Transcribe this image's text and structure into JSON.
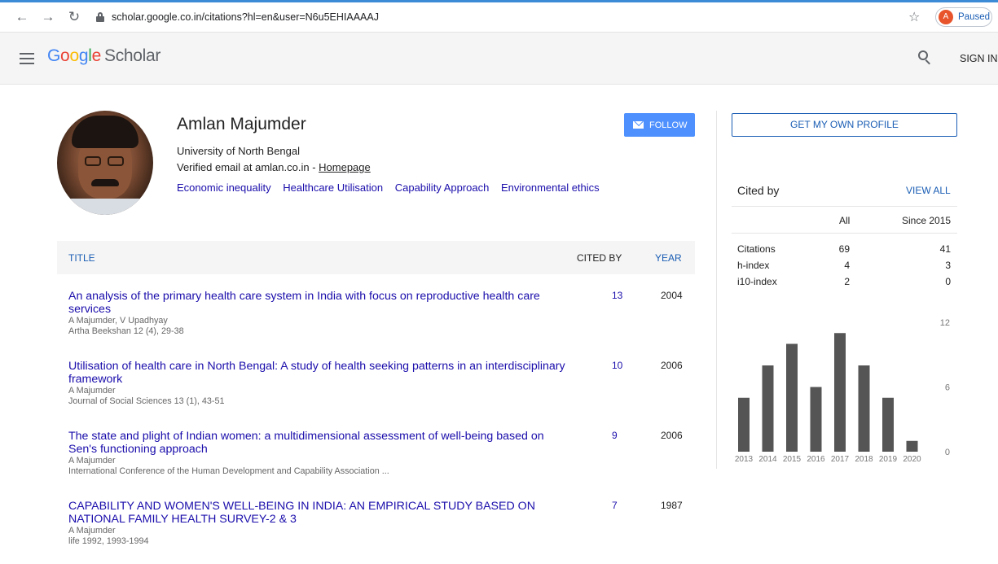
{
  "browser": {
    "back_icon": "arrow-left-icon",
    "forward_icon": "arrow-right-icon",
    "reload_icon": "reload-icon",
    "url": "scholar.google.co.in/citations?hl=en&user=N6u5EHIAAAAJ",
    "profile_initial": "A",
    "profile_status": "Paused"
  },
  "header": {
    "logo_google": [
      "G",
      "o",
      "o",
      "g",
      "l",
      "e"
    ],
    "logo_scholar": "Scholar",
    "sign_in": "SIGN IN"
  },
  "profile": {
    "name": "Amlan Majumder",
    "affiliation": "University of North Bengal",
    "email_text": "Verified email at amlan.co.in - ",
    "homepage": "Homepage",
    "interests": [
      "Economic inequality",
      "Healthcare Utilisation",
      "Capability Approach",
      "Environmental ethics"
    ],
    "follow_label": "FOLLOW"
  },
  "table": {
    "col_title": "TITLE",
    "col_cited": "CITED BY",
    "col_year": "YEAR",
    "rows": [
      {
        "title": "An analysis of the primary health care system in India with focus on reproductive health care services",
        "authors": "A Majumder, V Upadhyay",
        "venue": "Artha Beekshan 12 (4), 29-38",
        "cited": "13",
        "year": "2004"
      },
      {
        "title": "Utilisation of health care in North Bengal: A study of health seeking patterns in an interdisciplinary framework",
        "authors": "A Majumder",
        "venue": "Journal of Social Sciences 13 (1), 43-51",
        "cited": "10",
        "year": "2006"
      },
      {
        "title": "The state and plight of Indian women: a multidimensional assessment of well-being based on Sen's functioning approach",
        "authors": "A Majumder",
        "venue": "International Conference of the Human Development and Capability Association ...",
        "cited": "9",
        "year": "2006"
      },
      {
        "title": "CAPABILITY AND WOMEN'S WELL-BEING IN INDIA: AN EMPIRICAL STUDY BASED ON NATIONAL FAMILY HEALTH SURVEY-2 & 3",
        "authors": "A Majumder",
        "venue": "life 1992, 1993-1994",
        "cited": "7",
        "year": "1987"
      }
    ]
  },
  "sidebar": {
    "own_profile": "GET MY OWN PROFILE",
    "cited_by": "Cited by",
    "view_all": "VIEW ALL",
    "col_all": "All",
    "col_since": "Since 2015",
    "stats": [
      {
        "label": "Citations",
        "all": "69",
        "since": "41"
      },
      {
        "label": "h-index",
        "all": "4",
        "since": "3"
      },
      {
        "label": "i10-index",
        "all": "2",
        "since": "0"
      }
    ]
  },
  "chart_data": {
    "type": "bar",
    "categories": [
      "2013",
      "2014",
      "2015",
      "2016",
      "2017",
      "2018",
      "2019",
      "2020"
    ],
    "values": [
      5,
      8,
      10,
      6,
      11,
      8,
      5,
      1
    ],
    "y_ticks": [
      "0",
      "6",
      "12"
    ],
    "ylim": [
      0,
      12
    ],
    "bar_color": "#555555"
  }
}
